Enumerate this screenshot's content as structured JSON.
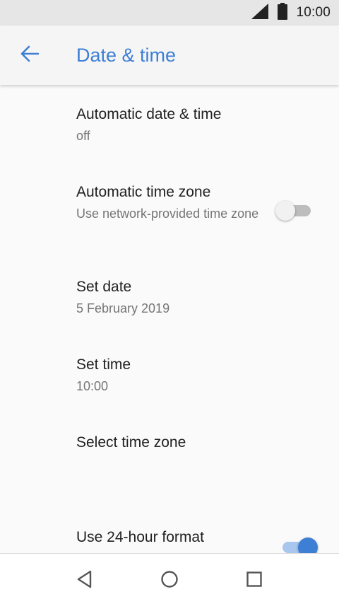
{
  "status_bar": {
    "time": "10:00",
    "icons": [
      "cellular-signal-icon",
      "battery-icon"
    ]
  },
  "app_bar": {
    "title": "Date & time",
    "back_icon": "arrow-back-icon"
  },
  "preferences": [
    {
      "title": "Automatic date & time",
      "summary": "off"
    },
    {
      "title": "Automatic time zone",
      "summary": "Use network-provided time zone",
      "switch": false
    },
    {
      "title": "Set date",
      "summary": "5 February 2019"
    },
    {
      "title": "Set time",
      "summary": "10:00"
    },
    {
      "title": "Select time zone"
    },
    {
      "title": "Use 24-hour format",
      "switch": true
    }
  ],
  "nav_bar": {
    "icons": [
      "back-triangle-icon",
      "home-circle-icon",
      "recents-square-icon"
    ]
  },
  "colors": {
    "accent": "#3d7fd4",
    "status_bar": "#e6e6e6",
    "app_bar": "#f5f5f5",
    "background": "#fafafa"
  }
}
